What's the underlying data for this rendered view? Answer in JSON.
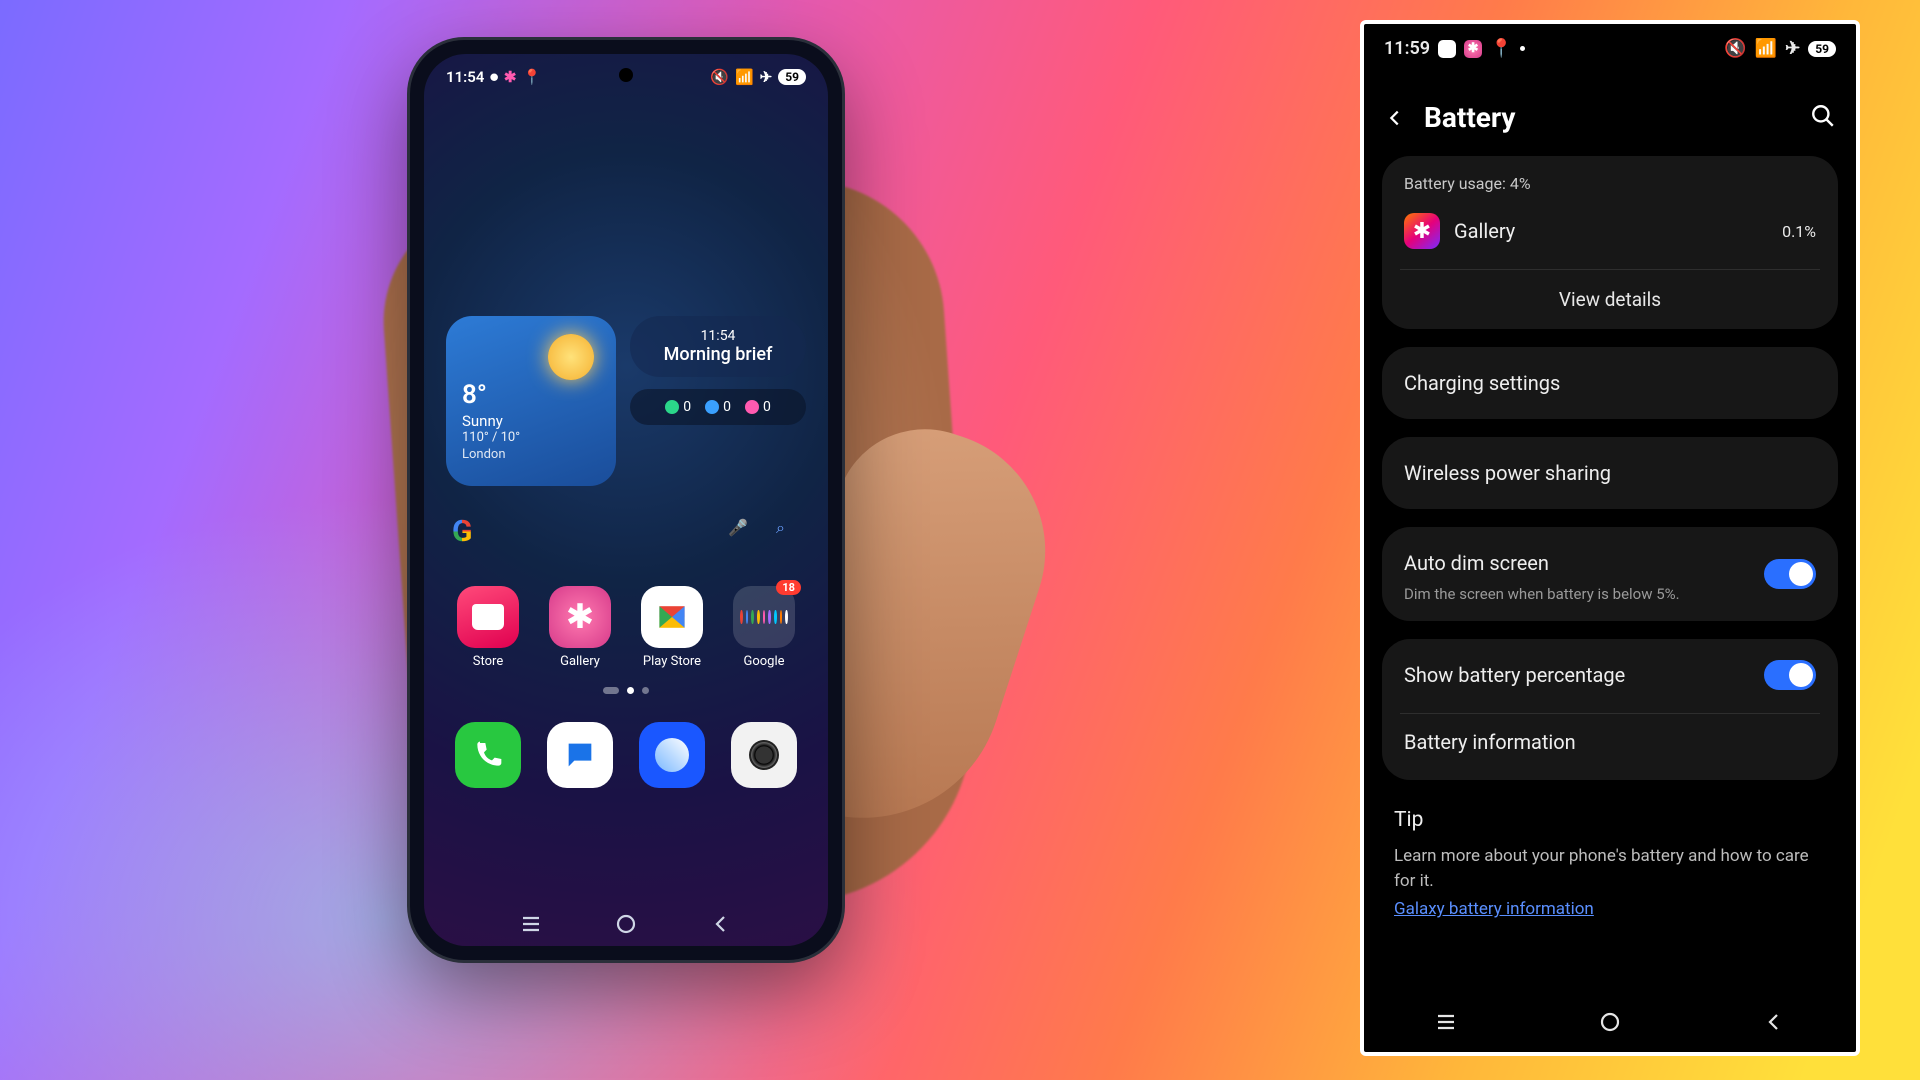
{
  "left_phone": {
    "status": {
      "time": "11:54",
      "battery": "59"
    },
    "weather": {
      "temp": "8°",
      "condition": "Sunny",
      "range": "110° / 10°",
      "city": "London"
    },
    "brief": {
      "time": "11:54",
      "label": "Morning brief"
    },
    "health": {
      "steps": "0",
      "cal": "0",
      "heart": "0"
    },
    "apps": {
      "store": "Store",
      "gallery": "Gallery",
      "play": "Play Store",
      "google": "Google",
      "google_badge": "18"
    }
  },
  "right_phone": {
    "status": {
      "time": "11:59",
      "battery": "59"
    },
    "header": {
      "title": "Battery"
    },
    "usage": {
      "label": "Battery usage: 4%",
      "app_name": "Gallery",
      "app_pct": "0.1%",
      "view_details": "View details"
    },
    "rows": {
      "charging": "Charging settings",
      "wireless": "Wireless power sharing",
      "autodim": "Auto dim screen",
      "autodim_sub": "Dim the screen when battery is below 5%.",
      "showpct": "Show battery percentage",
      "battinfo": "Battery information"
    },
    "tip": {
      "title": "Tip",
      "text": "Learn more about your phone's battery and how to care for it.",
      "link": "Galaxy battery information"
    }
  }
}
